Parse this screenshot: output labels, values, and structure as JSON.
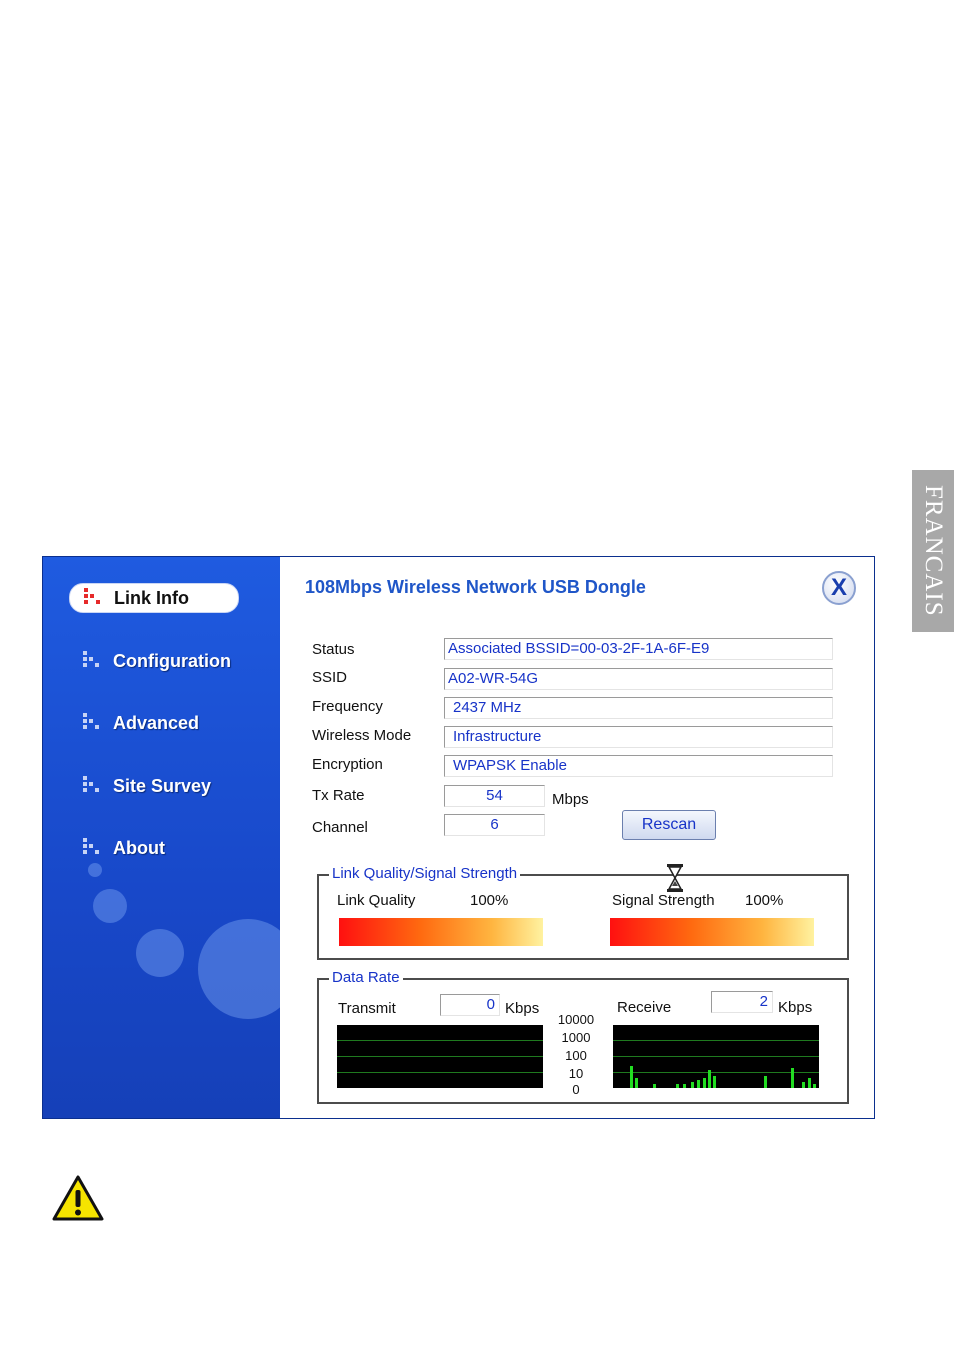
{
  "side_tab": {
    "label": "FRANCAIS"
  },
  "sidebar": {
    "items": [
      {
        "label": "Link Info",
        "active": true
      },
      {
        "label": "Configuration",
        "active": false
      },
      {
        "label": "Advanced",
        "active": false
      },
      {
        "label": "Site Survey",
        "active": false
      },
      {
        "label": "About",
        "active": false
      }
    ]
  },
  "window": {
    "title": "108Mbps Wireless Network USB Dongle",
    "close_label": "X"
  },
  "info": {
    "status_label": "Status",
    "status_value": "Associated BSSID=00-03-2F-1A-6F-E9",
    "ssid_label": "SSID",
    "ssid_value": "A02-WR-54G",
    "frequency_label": "Frequency",
    "frequency_value": "2437 MHz",
    "mode_label": "Wireless Mode",
    "mode_value": "Infrastructure",
    "encryption_label": "Encryption",
    "encryption_value": "WPAPSK Enable",
    "txrate_label": "Tx Rate",
    "txrate_value": "54",
    "txrate_unit": "Mbps",
    "channel_label": "Channel",
    "channel_value": "6",
    "rescan_label": "Rescan"
  },
  "link_quality": {
    "group_title": "Link Quality/Signal Strength",
    "quality_label": "Link Quality",
    "quality_value": "100%",
    "quality_level": 1.0,
    "signal_label": "Signal Strength",
    "signal_value": "100%",
    "signal_level": 1.0
  },
  "data_rate": {
    "group_title": "Data Rate",
    "transmit_label": "Transmit",
    "transmit_value": "0",
    "transmit_unit": "Kbps",
    "receive_label": "Receive",
    "receive_value": "2",
    "receive_unit": "Kbps",
    "scale": [
      "10000",
      "1000",
      "100",
      "10",
      "0"
    ]
  },
  "colors": {
    "sidebar_blue": "#1a4fc8",
    "title_blue": "#1f56c8",
    "value_blue": "#1733c8",
    "graph_green": "#22dd22"
  },
  "icons": [
    "dots-nav-icon",
    "close-icon",
    "hourglass-icon",
    "warning-icon"
  ]
}
